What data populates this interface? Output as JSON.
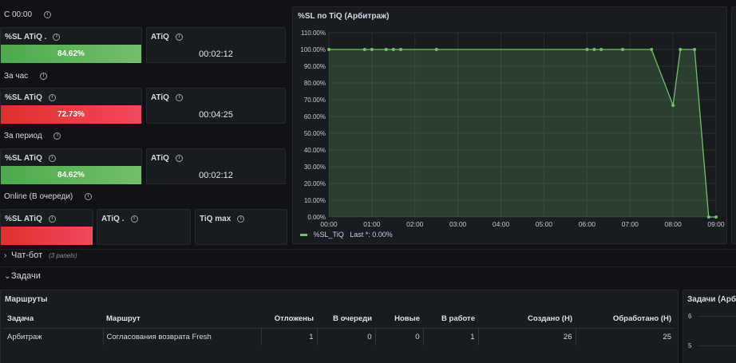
{
  "sections": {
    "since_midnight": "С 00:00",
    "per_hour": "За час",
    "per_period": "За период",
    "online": "Online (В очереди)"
  },
  "stats": {
    "sl_label_1": "%SL ATiQ .",
    "sl_value_1": "84.62%",
    "atiq_label_1": "ATiQ",
    "atiq_value_1": "00:02:12",
    "sl_label_2": "%SL ATiQ",
    "sl_value_2": "72.73%",
    "atiq_label_2": "ATiQ",
    "atiq_value_2": "00:04:25",
    "sl_label_3": "%SL ATiQ",
    "sl_value_3": "84.62%",
    "atiq_label_3": "ATiQ",
    "atiq_value_3": "00:02:12",
    "sl_label_4": "%SL ATiQ",
    "atiq_label_4": "ATiQ .",
    "tiqmax_label_4": "TiQ max",
    "bar_level_1": 0.8462,
    "bar_level_2": 0.7273,
    "bar_level_3": 0.8462
  },
  "chart_data": {
    "type": "line",
    "title": "%SL по TiQ (Арбитраж)",
    "yticks": [
      "110.00%",
      "100.00%",
      "90.00%",
      "80.00%",
      "70.00%",
      "60.00%",
      "50.00%",
      "40.00%",
      "30.00%",
      "20.00%",
      "10.00%",
      "0.00%"
    ],
    "xticks": [
      "00:00",
      "01:00",
      "02:00",
      "03:00",
      "04:00",
      "05:00",
      "06:00",
      "07:00",
      "08:00",
      "09:00"
    ],
    "ylim": [
      0,
      110
    ],
    "xlim_hours": [
      0,
      9
    ],
    "series": [
      {
        "name": "%SL_TiQ",
        "color": "#73bf69",
        "x_hours": [
          0.0,
          0.83,
          1.0,
          1.33,
          1.5,
          1.67,
          2.5,
          6.0,
          6.17,
          6.33,
          6.83,
          7.5,
          8.0,
          8.17,
          8.5,
          8.83,
          9.0
        ],
        "values": [
          100,
          100,
          100,
          100,
          100,
          100,
          100,
          100,
          100,
          100,
          100,
          100,
          66.67,
          100,
          100,
          0,
          0
        ]
      }
    ],
    "legend_last_label": "Last *:",
    "legend_last_value": "0.00%",
    "legend_position": "bottom-left",
    "grid": true
  },
  "rows": {
    "chatbot": "Чат-бот",
    "chatbot_count": "(3 panels)",
    "tasks": "Задачи"
  },
  "routes_table": {
    "title": "Маршруты",
    "headers": [
      "Задача",
      "Маршрут",
      "Отложены",
      "В очереди",
      "Новые",
      "В работе",
      "Создано (Н)",
      "Обработано (Н)"
    ],
    "rows": [
      [
        "Арбитраж",
        "Согласования возврата Fresh",
        "1",
        "0",
        "0",
        "1",
        "26",
        "25"
      ]
    ]
  },
  "side_panel": {
    "title": "Задачи (Арби",
    "yticks": [
      "6",
      "5"
    ]
  }
}
